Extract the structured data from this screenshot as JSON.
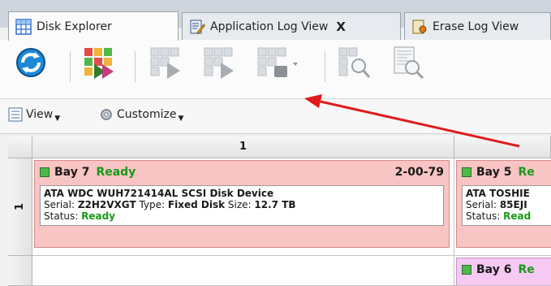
{
  "tabs": [
    {
      "label": "Disk Explorer",
      "icon": "grid-icon",
      "active": true
    },
    {
      "label": "Application Log View",
      "icon": "log-edit-icon",
      "active": false,
      "close": "X"
    },
    {
      "label": "Erase Log View",
      "icon": "erase-log-icon",
      "active": false
    }
  ],
  "toolbar": {
    "buttons": [
      "refresh-icon",
      "erase-all-icon",
      "erase-selected-icon",
      "erase-next-icon",
      "erase-options-icon",
      "find-icon",
      "report-icon"
    ]
  },
  "subbar": {
    "view_label": "View",
    "customize_label": "Customize"
  },
  "grid": {
    "column_header": "1",
    "row_header": "1",
    "bays": [
      {
        "name": "Bay 7",
        "status": "Ready",
        "code": "2-00-79",
        "disk_name": "ATA WDC WUH721414AL SCSI Disk Device",
        "serial_label": "Serial:",
        "serial": "Z2H2VXGT",
        "type_label": "Type:",
        "type": "Fixed Disk",
        "size_label": "Size:",
        "size": "12.7 TB",
        "status_label": "Status:",
        "disk_status": "Ready"
      },
      {
        "name": "Bay 5",
        "status": "Re",
        "disk_name": "ATA TOSHIE",
        "serial_label": "Serial:",
        "serial": "85EJI",
        "status_label": "Status:",
        "disk_status": "Read"
      },
      {
        "name": "Bay 6",
        "status": "Re"
      }
    ]
  },
  "colors": {
    "bay_ready_bg": "#f8c4c4",
    "bay_pink_bg": "#f6c9f2",
    "status_green": "#179a17",
    "annotation_arrow": "#e01b1b"
  }
}
